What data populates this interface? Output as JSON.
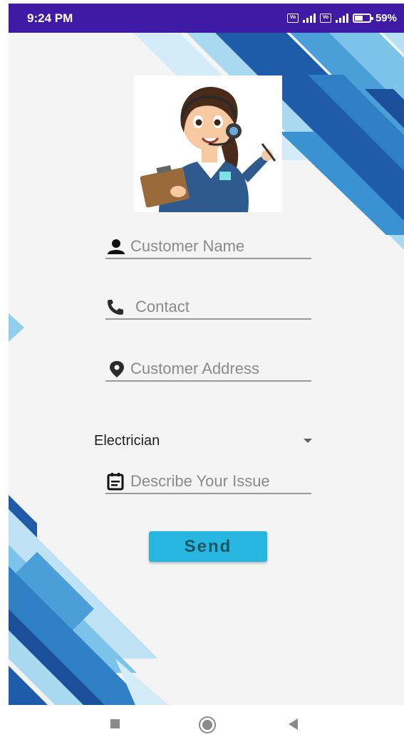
{
  "status_bar": {
    "time": "9:24 PM",
    "sim1_label": "Vo LTE",
    "sim2_label": "Vo LTE",
    "network_type": "4G",
    "battery": "59%"
  },
  "form": {
    "name_placeholder": "Customer Name",
    "contact_placeholder": "Contact",
    "address_placeholder": "Customer Address",
    "service_selected": "Electrician",
    "issue_placeholder": "Describe Your Issue",
    "send_label": "Send"
  },
  "icons": {
    "name": "person-icon",
    "contact": "phone-icon",
    "address": "location-pin-icon",
    "issue": "description-icon",
    "avatar": "support-agent-illustration"
  },
  "colors": {
    "status_bar": "#3f1aa6",
    "button": "#27b6e0",
    "button_text": "#1c5563",
    "accent_dark": "#1a5aa6",
    "accent_light": "#79c3ea"
  },
  "nav_bar": {
    "recent": "recent-apps-icon",
    "home": "home-icon",
    "back": "back-icon"
  }
}
